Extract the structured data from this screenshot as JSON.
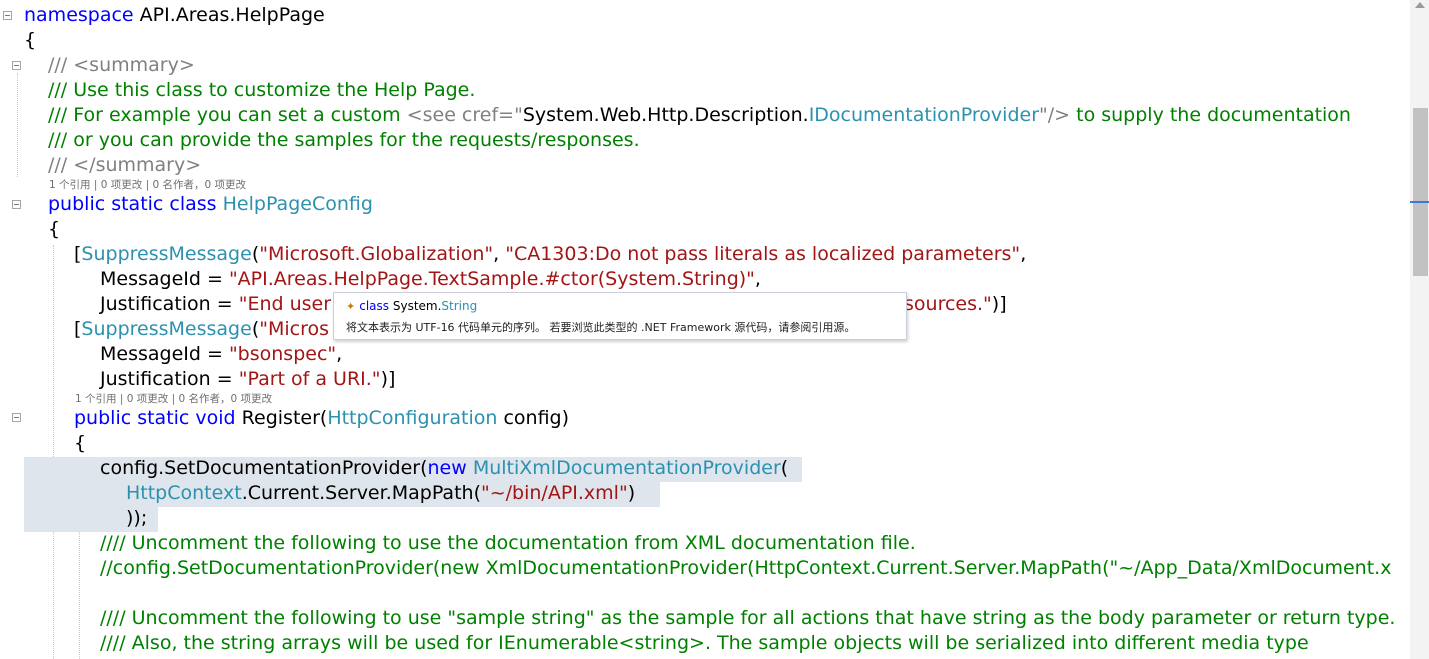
{
  "code": {
    "l1": {
      "kw": "namespace",
      "rest": " API.Areas.HelpPage"
    },
    "l2": "{",
    "l3": {
      "a": "/// ",
      "b": "<summary>"
    },
    "l4": "/// Use this class to customize the Help Page.",
    "l5": {
      "a": "/// For example you can set a custom ",
      "b": "<see cref=\"",
      "c": "System.Web.Http.Description.",
      "d": "IDocumentationProvider",
      "e": "\"/>",
      "f": " to supply the documentation"
    },
    "l6": "/// or you can provide the samples for the requests/responses.",
    "l7": {
      "a": "/// ",
      "b": "</summary>"
    },
    "lens1": "1 个引用 | 0 项更改 | 0 名作者，0 项更改",
    "l8": {
      "kw": "public static class",
      "ty": "HelpPageConfig"
    },
    "l9": "{",
    "l10": {
      "open": "[",
      "ty": "SuppressMessage",
      "p1": "(",
      "s1": "\"Microsoft.Globalization\"",
      "p2": ", ",
      "s2": "\"CA1303:Do not pass literals as localized parameters\"",
      "p3": ","
    },
    "l11": {
      "a": "MessageId = ",
      "s": "\"API.Areas.HelpPage.TextSample.#ctor(System.String)\"",
      "b": ","
    },
    "l12": {
      "a": "Justification = ",
      "s1": "\"End user",
      "s2": "sources.\"",
      "b": ")]"
    },
    "l13": {
      "open": "[",
      "ty": "SuppressMessage",
      "p1": "(",
      "s": "\"Micros"
    },
    "l14": {
      "a": "MessageId = ",
      "s": "\"bsonspec\"",
      "b": ","
    },
    "l15": {
      "a": "Justification = ",
      "s": "\"Part of a URI.\"",
      "b": ")]"
    },
    "lens2": "1 个引用 | 0 项更改 | 0 名作者，0 项更改",
    "l16": {
      "kw": "public static void",
      "a": " Register(",
      "ty": "HttpConfiguration",
      "b": " config)"
    },
    "l17": "{",
    "l18": {
      "a": "config.SetDocumentationProvider(",
      "kw": "new",
      "ty": "MultiXmlDocumentationProvider",
      "b": "("
    },
    "l19": {
      "ty": "HttpContext",
      "a": ".Current.Server.MapPath(",
      "s": "\"~/bin/API.xml\"",
      "b": ")"
    },
    "l20": "));",
    "l21": "//// Uncomment the following to use the documentation from XML documentation file.",
    "l22": "//config.SetDocumentationProvider(new XmlDocumentationProvider(HttpContext.Current.Server.MapPath(\"~/App_Data/XmlDocument.x",
    "l23": "//// Uncomment the following to use \"sample string\" as the sample for all actions that have string as the body parameter or return type.",
    "l24": "//// Also, the string arrays will be used for IEnumerable<string>. The sample objects will be serialized into different media type"
  },
  "tooltip": {
    "kw": "class",
    "type_ns": "System.",
    "type_name": "String",
    "description": "将文本表示为 UTF-16 代码单元的序列。 若要浏览此类型的 .NET Framework 源代码，请参阅引用源。",
    "icon": "class-icon"
  },
  "colors": {
    "keyword": "#0000ff",
    "type": "#2b91af",
    "string": "#a31515",
    "comment": "#008000",
    "doc_tag": "#808080",
    "highlight": "#dfe5ec"
  }
}
